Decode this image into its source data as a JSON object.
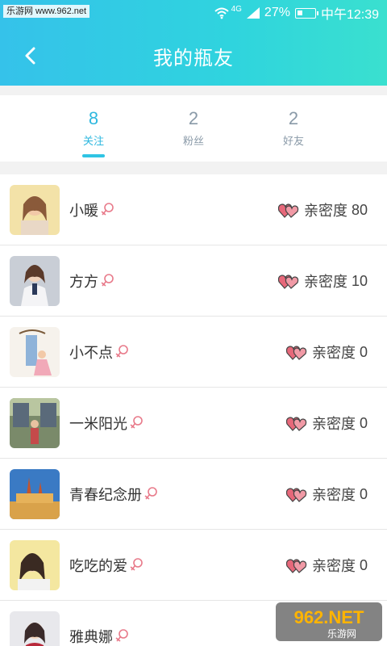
{
  "status_bar": {
    "watermark": "乐游网 www.962.net",
    "network": "4G",
    "battery": "27%",
    "time": "中午12:39"
  },
  "header": {
    "title": "我的瓶友",
    "back_icon": "chevron-left-icon"
  },
  "tabs": [
    {
      "count": "8",
      "label": "关注",
      "active": true
    },
    {
      "count": "2",
      "label": "粉丝",
      "active": false
    },
    {
      "count": "2",
      "label": "好友",
      "active": false
    }
  ],
  "friends": [
    {
      "name": "小暖",
      "gender_icon": "female-icon",
      "intimacy_label": "亲密度",
      "intimacy": "80"
    },
    {
      "name": "方方",
      "gender_icon": "female-icon",
      "intimacy_label": "亲密度",
      "intimacy": "10"
    },
    {
      "name": "小不点",
      "gender_icon": "female-icon",
      "intimacy_label": "亲密度",
      "intimacy": "0"
    },
    {
      "name": "一米阳光",
      "gender_icon": "female-icon",
      "intimacy_label": "亲密度",
      "intimacy": "0"
    },
    {
      "name": "青春纪念册",
      "gender_icon": "female-icon",
      "intimacy_label": "亲密度",
      "intimacy": "0"
    },
    {
      "name": "吃吃的爱",
      "gender_icon": "female-icon",
      "intimacy_label": "亲密度",
      "intimacy": "0"
    },
    {
      "name": "雅典娜",
      "gender_icon": "female-icon",
      "intimacy_label": "",
      "intimacy": ""
    }
  ],
  "corner_logo": {
    "brand": "962.NET",
    "sub": "乐游网"
  },
  "colors": {
    "accent": "#2fb8df",
    "header_start": "#35c2ea",
    "header_end": "#3ae0cf",
    "female": "#e87a8a"
  }
}
